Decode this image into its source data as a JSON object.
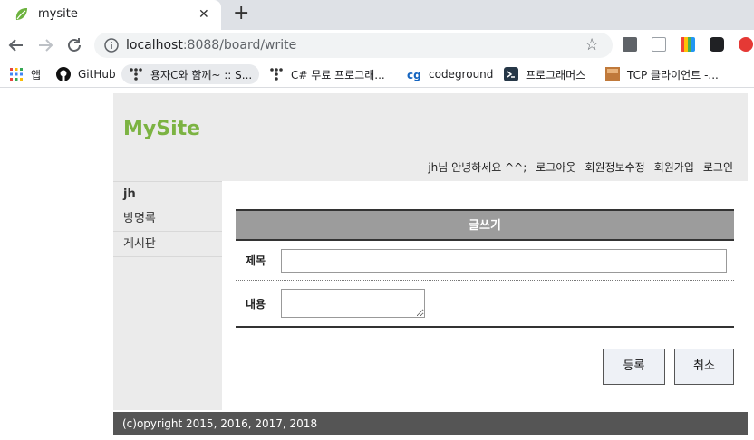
{
  "browser": {
    "tab_title": "mysite",
    "tab_close": "✕",
    "new_tab": "+",
    "url_host": "localhost",
    "url_path": ":8088/board/write",
    "star": "☆",
    "bookmarks": [
      {
        "label": "앱"
      },
      {
        "label": "GitHub"
      },
      {
        "label": "용자C와 함께~ :: S..."
      },
      {
        "label": "C# 무료 프로그래..."
      },
      {
        "label": "codeground"
      },
      {
        "label": "프로그래머스"
      },
      {
        "label": "TCP 클라이언트 -..."
      }
    ]
  },
  "site": {
    "title": "MySite",
    "greeting": "jh님 안녕하세요 ^^;",
    "nav": {
      "logout": "로그아웃",
      "edit_profile": "회원정보수정",
      "signup": "회원가입",
      "login": "로그인"
    }
  },
  "sidebar": {
    "items": [
      {
        "label": "jh"
      },
      {
        "label": "방명록"
      },
      {
        "label": "게시판"
      }
    ]
  },
  "form": {
    "heading": "글쓰기",
    "title_label": "제목",
    "title_value": "",
    "content_label": "내용",
    "content_value": "",
    "submit_label": "등록",
    "cancel_label": "취소"
  },
  "footer": {
    "text": "(c)opyright 2015, 2016, 2017, 2018"
  },
  "colors": {
    "brand": "#7cb342",
    "form_header": "#9c9c9c",
    "footer_bg": "#555555"
  }
}
